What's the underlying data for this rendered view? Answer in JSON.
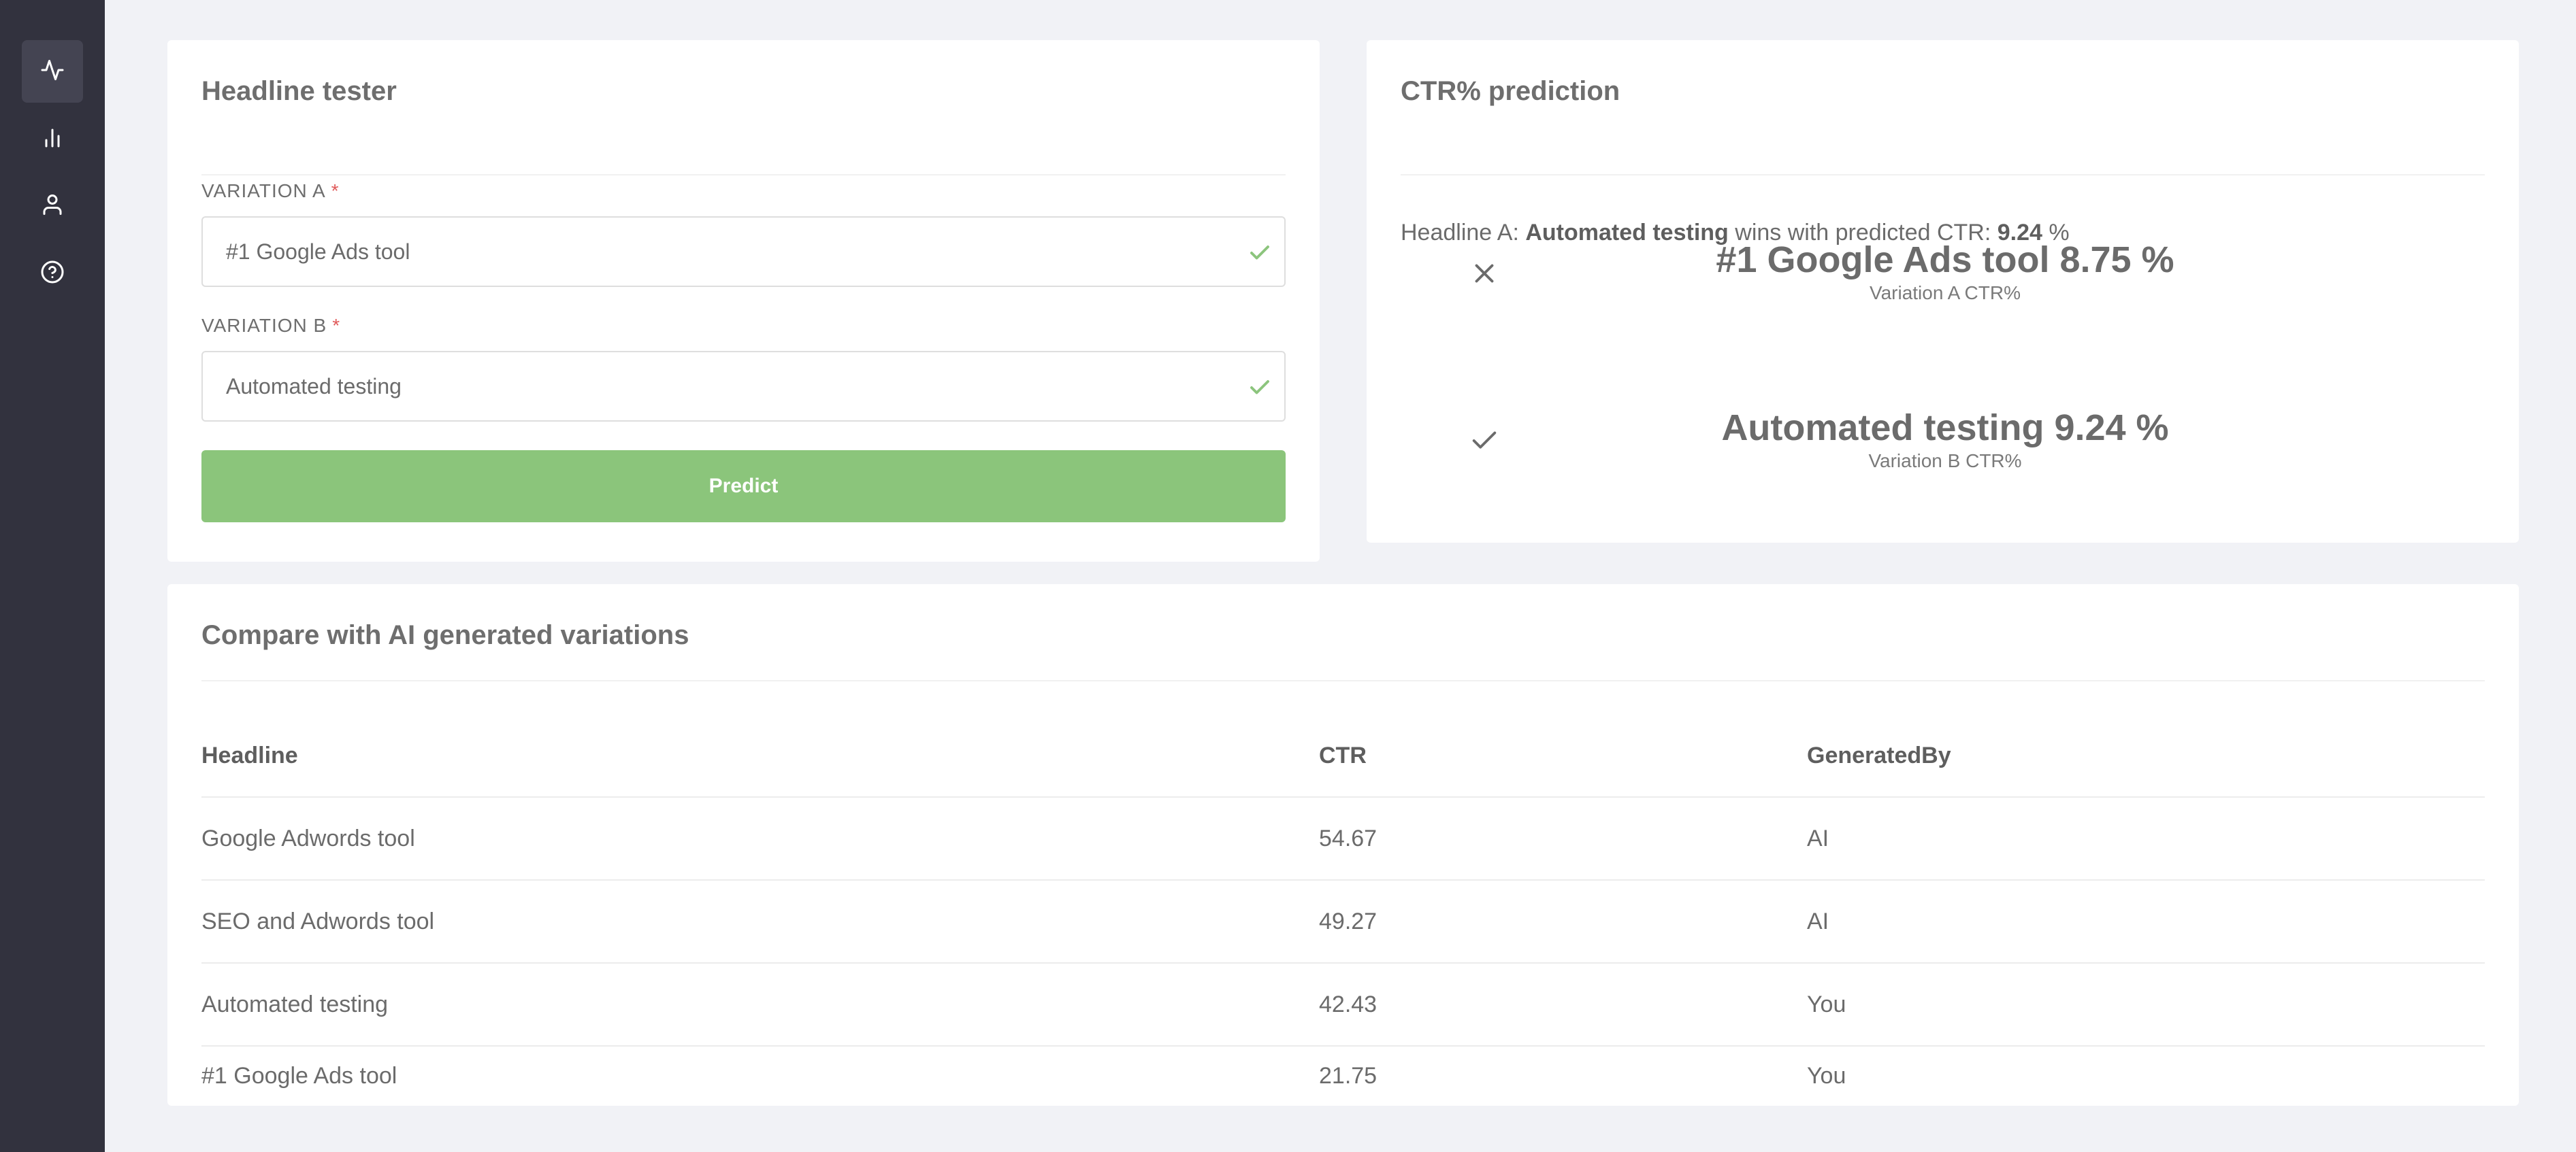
{
  "sidebar": {
    "items": [
      {
        "icon": "activity-icon",
        "active": true
      },
      {
        "icon": "bar-chart-icon",
        "active": false
      },
      {
        "icon": "user-icon",
        "active": false
      },
      {
        "icon": "help-circle-icon",
        "active": false
      }
    ]
  },
  "tester": {
    "title": "Headline tester",
    "variation_a": {
      "label": "VARIATION A",
      "required_mark": "*",
      "value": "#1 Google Ads tool"
    },
    "variation_b": {
      "label": "VARIATION B",
      "required_mark": "*",
      "value": "Automated testing"
    },
    "predict_label": "Predict"
  },
  "prediction": {
    "title": "CTR% prediction",
    "winner_prefix": "Headline A:",
    "winner_name": "Automated testing",
    "winner_middle": "wins with predicted CTR:",
    "winner_value": "9.24",
    "winner_unit": "%",
    "results": [
      {
        "status": "close-icon",
        "headline": "#1 Google Ads tool 8.75 %",
        "caption": "Variation A CTR%"
      },
      {
        "status": "check-icon",
        "headline": "Automated testing 9.24 %",
        "caption": "Variation B CTR%"
      }
    ]
  },
  "compare": {
    "title": "Compare with AI generated variations",
    "columns": [
      "Headline",
      "CTR",
      "GeneratedBy"
    ],
    "rows": [
      {
        "headline": "Google Adwords tool",
        "ctr": "54.67",
        "generated_by": "AI"
      },
      {
        "headline": "SEO and Adwords tool",
        "ctr": "49.27",
        "generated_by": "AI"
      },
      {
        "headline": "Automated testing",
        "ctr": "42.43",
        "generated_by": "You"
      },
      {
        "headline": "#1 Google Ads tool",
        "ctr": "21.75",
        "generated_by": "You"
      }
    ]
  },
  "colors": {
    "sidebar_bg": "#32323e",
    "page_bg": "#f1f2f6",
    "accent_green": "#8bc57b",
    "required_red": "#e05a5a"
  }
}
